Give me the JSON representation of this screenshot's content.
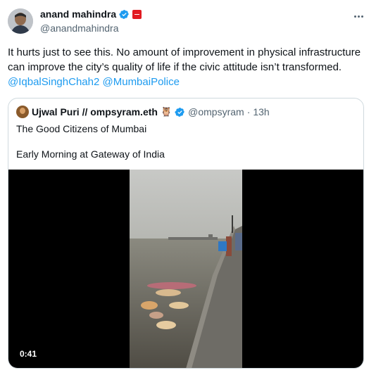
{
  "tweet": {
    "author": {
      "display_name": "anand mahindra",
      "handle": "@anandmahindra",
      "verified_icon": "verified-badge-icon",
      "affiliation_icon": "red-affiliate-badge-icon"
    },
    "text": "It hurts just to see this. No amount of improvement in physical infrastructure can improve the city’s quality of life if the civic attitude isn’t transformed.",
    "mentions": [
      "@IqbalSinghChah2",
      "@MumbaiPolice"
    ],
    "more_icon": "more-options-icon"
  },
  "quoted_tweet": {
    "display_name": "Ujwal Puri // ompsyram.eth",
    "emoji": "🦉",
    "handle": "@ompsyram",
    "separator": "·",
    "time": "13h",
    "line1": "The Good Citizens of Mumbai",
    "line2": "Early Morning at Gateway of India",
    "video": {
      "duration": "0:41"
    }
  },
  "colors": {
    "accent": "#1d9bf0",
    "muted": "#536471",
    "border": "#cfd9de",
    "badge_red": "#e11b22"
  }
}
